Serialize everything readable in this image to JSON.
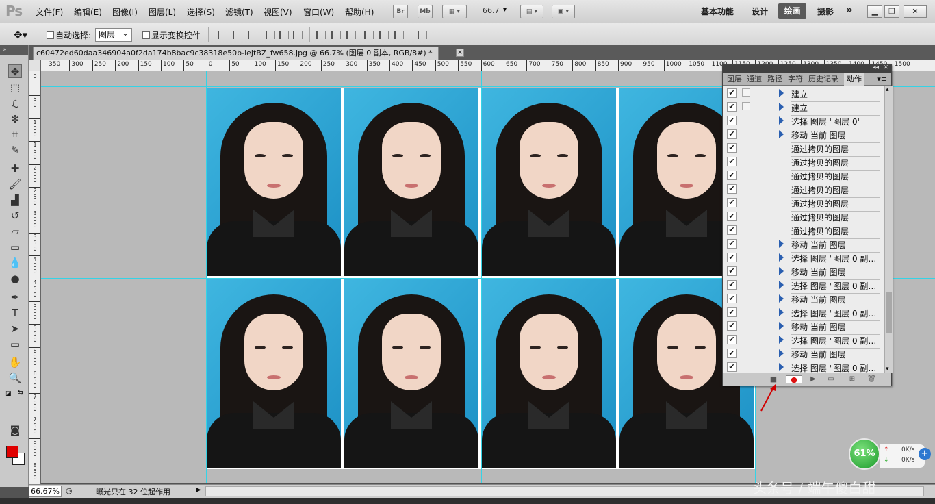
{
  "app": {
    "logo": "Ps"
  },
  "menu": [
    {
      "label": "文件(F)"
    },
    {
      "label": "编辑(E)"
    },
    {
      "label": "图像(I)"
    },
    {
      "label": "图层(L)"
    },
    {
      "label": "选择(S)"
    },
    {
      "label": "滤镜(T)"
    },
    {
      "label": "视图(V)"
    },
    {
      "label": "窗口(W)"
    },
    {
      "label": "帮助(H)"
    }
  ],
  "menubar": {
    "br_label": "Br",
    "mb_label": "Mb",
    "zoom_value": "66.7"
  },
  "workspaces": {
    "basic": "基本功能",
    "design": "设计",
    "paint": "绘画",
    "photo": "摄影",
    "more": "»"
  },
  "options": {
    "auto_select_label": "自动选择:",
    "auto_select_value": "图层",
    "show_transform_label": "显示变换控件"
  },
  "document": {
    "tab_title": "c60472ed60daa346904a0f2da174b8bac9c38318e50b-lejtBZ_fw658.jpg @ 66.7% (图层 0 副本, RGB/8#) *",
    "close": "×"
  },
  "ruler_top": [
    "350",
    "300",
    "250",
    "200",
    "150",
    "100",
    "50",
    "0",
    "50",
    "100",
    "150",
    "200",
    "250",
    "300",
    "350",
    "400",
    "450",
    "500",
    "550",
    "600",
    "650",
    "700",
    "750",
    "800",
    "850",
    "900",
    "950",
    "1000",
    "1050",
    "1100",
    "1150",
    "1200",
    "1250",
    "1300",
    "1350",
    "1400",
    "1450",
    "1500"
  ],
  "ruler_left": [
    "0",
    "5\n0",
    "1\n0\n0",
    "1\n5\n0",
    "2\n0\n0",
    "2\n5\n0",
    "3\n0\n0",
    "3\n5\n0",
    "4\n0\n0",
    "4\n5\n0",
    "5\n0\n0",
    "5\n5\n0",
    "6\n0\n0",
    "6\n5\n0",
    "7\n0\n0",
    "7\n5\n0",
    "8\n0\n0",
    "8\n5\n0",
    "9\n0\n0"
  ],
  "panel": {
    "tabs": [
      "图层",
      "通道",
      "路径",
      "字符",
      "历史记录",
      "动作"
    ],
    "active_tab": "动作",
    "actions": [
      {
        "label": "建立",
        "expand": true,
        "dialog": true
      },
      {
        "label": "建立",
        "expand": true,
        "dialog": true
      },
      {
        "label": "选择 图层 \"图层 0\"",
        "expand": true,
        "dialog": false
      },
      {
        "label": "移动 当前 图层",
        "expand": true,
        "dialog": false
      },
      {
        "label": "通过拷贝的图层",
        "expand": false,
        "dialog": false
      },
      {
        "label": "通过拷贝的图层",
        "expand": false,
        "dialog": false
      },
      {
        "label": "通过拷贝的图层",
        "expand": false,
        "dialog": false
      },
      {
        "label": "通过拷贝的图层",
        "expand": false,
        "dialog": false
      },
      {
        "label": "通过拷贝的图层",
        "expand": false,
        "dialog": false
      },
      {
        "label": "通过拷贝的图层",
        "expand": false,
        "dialog": false
      },
      {
        "label": "通过拷贝的图层",
        "expand": false,
        "dialog": false
      },
      {
        "label": "移动 当前 图层",
        "expand": true,
        "dialog": false
      },
      {
        "label": "选择 图层 \"图层 0 副本...",
        "expand": true,
        "dialog": false
      },
      {
        "label": "移动 当前 图层",
        "expand": true,
        "dialog": false
      },
      {
        "label": "选择 图层 \"图层 0 副本...",
        "expand": true,
        "dialog": false
      },
      {
        "label": "移动 当前 图层",
        "expand": true,
        "dialog": false
      },
      {
        "label": "选择 图层 \"图层 0 副本...",
        "expand": true,
        "dialog": false
      },
      {
        "label": "移动 当前 图层",
        "expand": true,
        "dialog": false
      },
      {
        "label": "选择 图层 \"图层 0 副本...",
        "expand": true,
        "dialog": false
      },
      {
        "label": "移动 当前 图层",
        "expand": true,
        "dialog": false
      },
      {
        "label": "选择 图层 \"图层 0 副本...",
        "expand": true,
        "dialog": false
      }
    ],
    "check": "✔"
  },
  "status": {
    "zoom": "66.67%",
    "text": "曝光只在 32 位起作用"
  },
  "net_widget": {
    "cpu": "61%",
    "up": "0K/s",
    "down": "0K/s",
    "plus": "+"
  },
  "watermark": "头条号 / 端午傻白甜",
  "colors": {
    "foreground": "#e00000",
    "background": "#ffffff",
    "guide": "#35d3e6",
    "photo_bg": "#2aa6d8"
  }
}
